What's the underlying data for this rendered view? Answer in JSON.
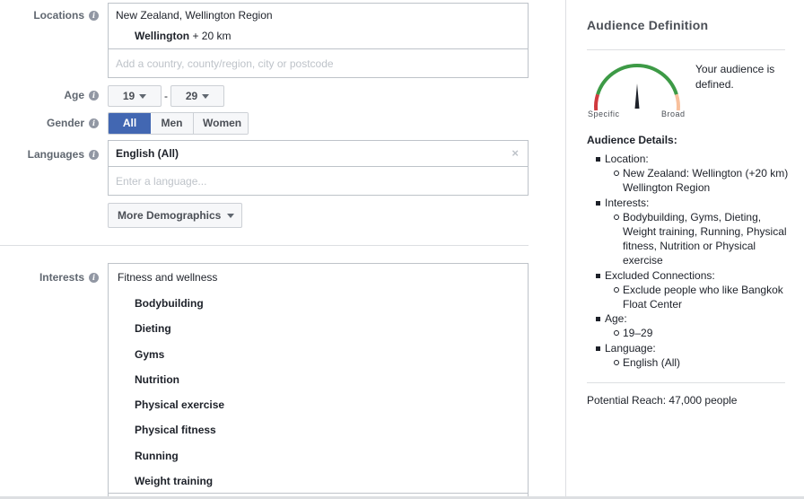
{
  "form": {
    "locations": {
      "label": "Locations",
      "region": "New Zealand, Wellington Region",
      "city": "Wellington",
      "radius": " + 20 km",
      "placeholder": "Add a country, county/region, city or postcode"
    },
    "age": {
      "label": "Age",
      "min": "19",
      "separator": "-",
      "max": "29"
    },
    "gender": {
      "label": "Gender",
      "options": [
        "All",
        "Men",
        "Women"
      ],
      "selected": "All"
    },
    "languages": {
      "label": "Languages",
      "selected": "English (All)",
      "remove_glyph": "×",
      "placeholder": "Enter a language..."
    },
    "more_demographics": "More Demographics",
    "interests": {
      "label": "Interests",
      "category": "Fitness and wellness",
      "items": [
        "Bodybuilding",
        "Dieting",
        "Gyms",
        "Nutrition",
        "Physical exercise",
        "Physical fitness",
        "Running",
        "Weight training"
      ]
    }
  },
  "audience": {
    "title": "Audience Definition",
    "gauge": {
      "left_label": "Specific",
      "right_label": "Broad",
      "needle_position": 0.5,
      "colors": {
        "specific": "#d0393e",
        "defined": "#3d9a46",
        "broad": "#f8c09c",
        "needle": "#1d2129"
      }
    },
    "status": "Your audience is defined.",
    "details_title": "Audience Details:",
    "details": [
      {
        "key": "Location:",
        "values": [
          "New Zealand: Wellington (+20 km) Wellington Region"
        ]
      },
      {
        "key": "Interests:",
        "values": [
          "Bodybuilding, Gyms, Dieting, Weight training, Running, Physical fitness, Nutrition or Physical exercise"
        ]
      },
      {
        "key": "Excluded Connections:",
        "values": [
          "Exclude people who like Bangkok Float Center"
        ]
      },
      {
        "key": "Age:",
        "values": [
          "19–29"
        ]
      },
      {
        "key": "Language:",
        "values": [
          "English (All)"
        ]
      }
    ],
    "potential_reach": "Potential Reach: 47,000 people"
  },
  "colors": {
    "accent": "#4267b2",
    "border": "#bec3c9",
    "label": "#606770"
  }
}
